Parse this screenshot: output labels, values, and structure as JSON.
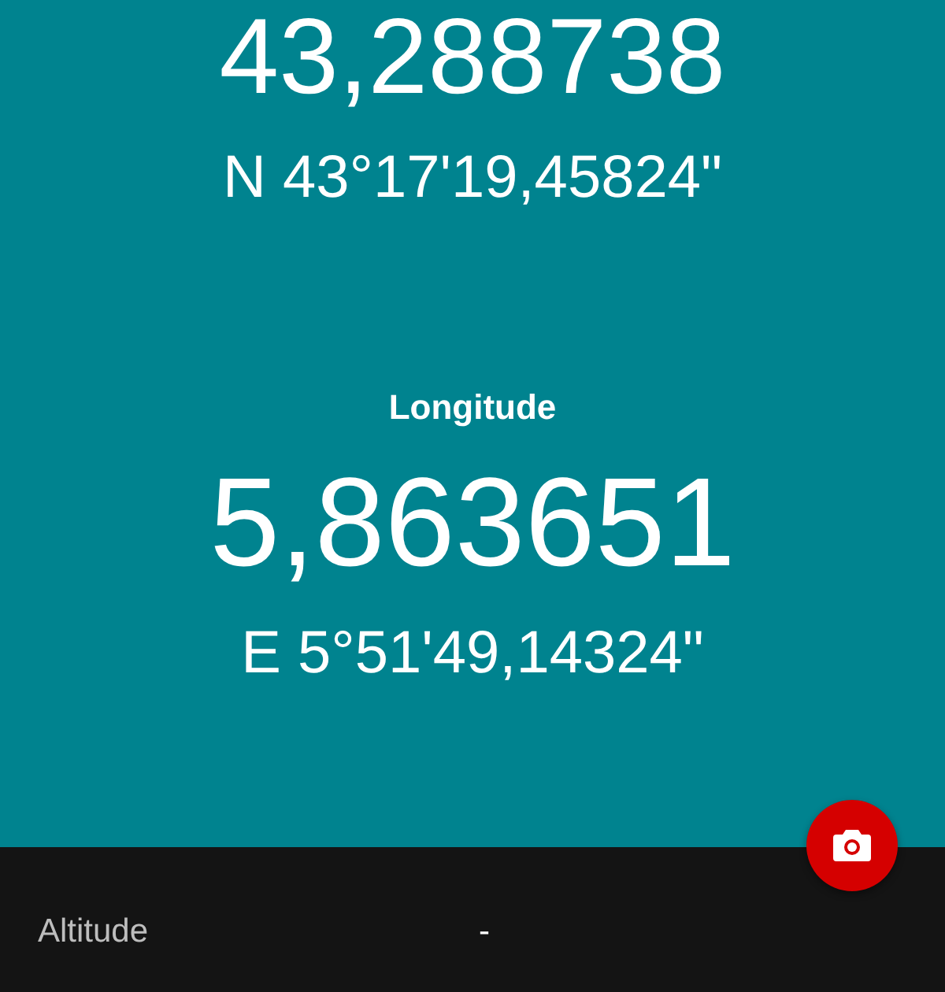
{
  "latitude": {
    "decimal": "43,288738",
    "dms": "N 43°17'19,45824\""
  },
  "longitude": {
    "label": "Longitude",
    "decimal": "5,863651",
    "dms": "E 5°51'49,14324\""
  },
  "altitude": {
    "label": "Altitude",
    "value": "-"
  }
}
